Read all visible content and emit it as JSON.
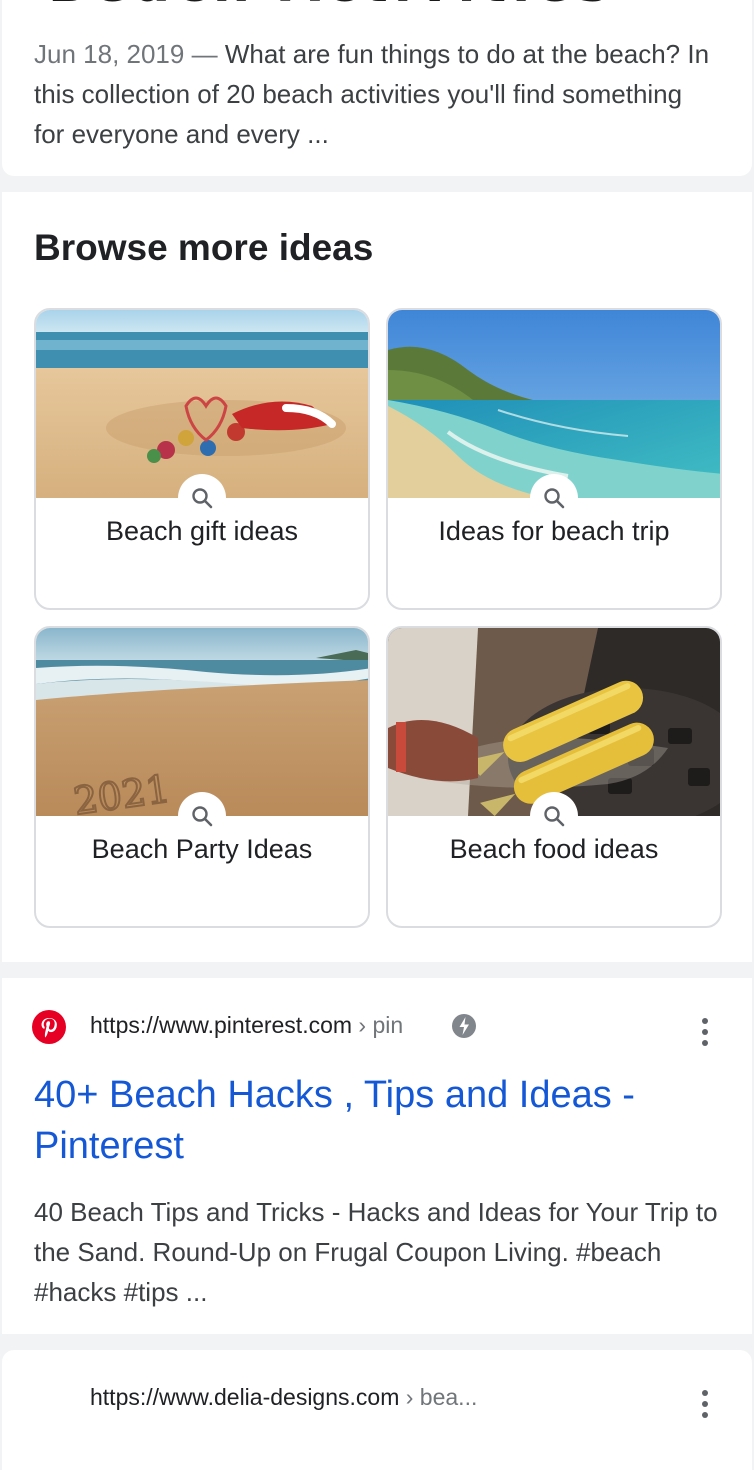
{
  "top_result": {
    "date": "Jun 18, 2019",
    "separator": "—",
    "snippet": "What are fun things to do at the beach? In this collection of 20 beach activities you'll find something for everyone and every ..."
  },
  "browse": {
    "title": "Browse more ideas",
    "tiles": [
      {
        "label": "Beach gift ideas"
      },
      {
        "label": "Ideas for beach trip"
      },
      {
        "label": "Beach Party Ideas"
      },
      {
        "label": "Beach food ideas"
      }
    ]
  },
  "pinterest_result": {
    "url": "https://www.pinterest.com",
    "path": " › pin",
    "title": "40+ Beach Hacks , Tips and Ideas - Pinterest",
    "snippet": "40 Beach Tips and Tricks - Hacks and Ideas for Your Trip to the Sand. Round-Up on Frugal Coupon Living. #beach #hacks #tips ..."
  },
  "delia_result": {
    "url": "https://www.delia-designs.com",
    "path": " › bea..."
  },
  "colors": {
    "link": "#1558d6",
    "pinterest_red": "#e60023",
    "background": "#f1f3f4"
  }
}
